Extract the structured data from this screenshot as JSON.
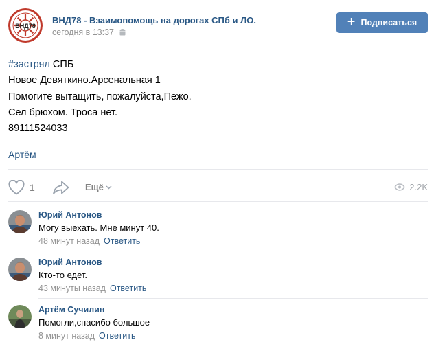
{
  "group": {
    "name": "ВНД78 - Взаимопомощь на дорогах СПб и ЛО.",
    "time": "сегодня в 13:37",
    "logo_text": "ВНД78"
  },
  "subscribe": {
    "label": "Подписаться"
  },
  "post": {
    "hashtag": "#застрял",
    "hashtag_suffix": " СПБ",
    "lines": [
      "Новое Девяткино.Арсенальная 1",
      "Помогите вытащить, пожалуйста,Пежо.",
      "Сел брюхом. Троса нет.",
      "89111524033"
    ],
    "signer": "Артём"
  },
  "actions": {
    "likes": "1",
    "more_label": "Ещё",
    "views": "2.2K"
  },
  "comments": [
    {
      "author": "Юрий Антонов",
      "text": "Могу выехать. Мне минут 40.",
      "time": "48 минут назад",
      "reply": "Ответить"
    },
    {
      "author": "Юрий Антонов",
      "text": "Кто-то едет.",
      "time": "43 минуты назад",
      "reply": "Ответить"
    },
    {
      "author": "Артём Сучилин",
      "text": "Помогли,спасибо большое",
      "time": "8 минут назад",
      "reply": "Ответить"
    }
  ],
  "colors": {
    "link": "#2a5885",
    "button": "#5181b8",
    "muted": "#939393",
    "divider": "#e7e8ec"
  }
}
